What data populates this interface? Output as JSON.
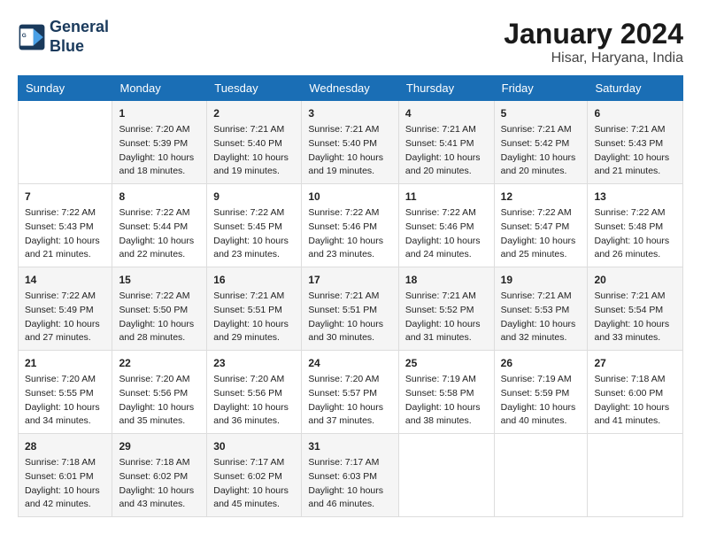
{
  "header": {
    "logo_line1": "General",
    "logo_line2": "Blue",
    "month_title": "January 2024",
    "location": "Hisar, Haryana, India"
  },
  "days_of_week": [
    "Sunday",
    "Monday",
    "Tuesday",
    "Wednesday",
    "Thursday",
    "Friday",
    "Saturday"
  ],
  "weeks": [
    [
      {
        "day": "",
        "sunrise": "",
        "sunset": "",
        "daylight": ""
      },
      {
        "day": "1",
        "sunrise": "Sunrise: 7:20 AM",
        "sunset": "Sunset: 5:39 PM",
        "daylight": "Daylight: 10 hours and 18 minutes."
      },
      {
        "day": "2",
        "sunrise": "Sunrise: 7:21 AM",
        "sunset": "Sunset: 5:40 PM",
        "daylight": "Daylight: 10 hours and 19 minutes."
      },
      {
        "day": "3",
        "sunrise": "Sunrise: 7:21 AM",
        "sunset": "Sunset: 5:40 PM",
        "daylight": "Daylight: 10 hours and 19 minutes."
      },
      {
        "day": "4",
        "sunrise": "Sunrise: 7:21 AM",
        "sunset": "Sunset: 5:41 PM",
        "daylight": "Daylight: 10 hours and 20 minutes."
      },
      {
        "day": "5",
        "sunrise": "Sunrise: 7:21 AM",
        "sunset": "Sunset: 5:42 PM",
        "daylight": "Daylight: 10 hours and 20 minutes."
      },
      {
        "day": "6",
        "sunrise": "Sunrise: 7:21 AM",
        "sunset": "Sunset: 5:43 PM",
        "daylight": "Daylight: 10 hours and 21 minutes."
      }
    ],
    [
      {
        "day": "7",
        "sunrise": "Sunrise: 7:22 AM",
        "sunset": "Sunset: 5:43 PM",
        "daylight": "Daylight: 10 hours and 21 minutes."
      },
      {
        "day": "8",
        "sunrise": "Sunrise: 7:22 AM",
        "sunset": "Sunset: 5:44 PM",
        "daylight": "Daylight: 10 hours and 22 minutes."
      },
      {
        "day": "9",
        "sunrise": "Sunrise: 7:22 AM",
        "sunset": "Sunset: 5:45 PM",
        "daylight": "Daylight: 10 hours and 23 minutes."
      },
      {
        "day": "10",
        "sunrise": "Sunrise: 7:22 AM",
        "sunset": "Sunset: 5:46 PM",
        "daylight": "Daylight: 10 hours and 23 minutes."
      },
      {
        "day": "11",
        "sunrise": "Sunrise: 7:22 AM",
        "sunset": "Sunset: 5:46 PM",
        "daylight": "Daylight: 10 hours and 24 minutes."
      },
      {
        "day": "12",
        "sunrise": "Sunrise: 7:22 AM",
        "sunset": "Sunset: 5:47 PM",
        "daylight": "Daylight: 10 hours and 25 minutes."
      },
      {
        "day": "13",
        "sunrise": "Sunrise: 7:22 AM",
        "sunset": "Sunset: 5:48 PM",
        "daylight": "Daylight: 10 hours and 26 minutes."
      }
    ],
    [
      {
        "day": "14",
        "sunrise": "Sunrise: 7:22 AM",
        "sunset": "Sunset: 5:49 PM",
        "daylight": "Daylight: 10 hours and 27 minutes."
      },
      {
        "day": "15",
        "sunrise": "Sunrise: 7:22 AM",
        "sunset": "Sunset: 5:50 PM",
        "daylight": "Daylight: 10 hours and 28 minutes."
      },
      {
        "day": "16",
        "sunrise": "Sunrise: 7:21 AM",
        "sunset": "Sunset: 5:51 PM",
        "daylight": "Daylight: 10 hours and 29 minutes."
      },
      {
        "day": "17",
        "sunrise": "Sunrise: 7:21 AM",
        "sunset": "Sunset: 5:51 PM",
        "daylight": "Daylight: 10 hours and 30 minutes."
      },
      {
        "day": "18",
        "sunrise": "Sunrise: 7:21 AM",
        "sunset": "Sunset: 5:52 PM",
        "daylight": "Daylight: 10 hours and 31 minutes."
      },
      {
        "day": "19",
        "sunrise": "Sunrise: 7:21 AM",
        "sunset": "Sunset: 5:53 PM",
        "daylight": "Daylight: 10 hours and 32 minutes."
      },
      {
        "day": "20",
        "sunrise": "Sunrise: 7:21 AM",
        "sunset": "Sunset: 5:54 PM",
        "daylight": "Daylight: 10 hours and 33 minutes."
      }
    ],
    [
      {
        "day": "21",
        "sunrise": "Sunrise: 7:20 AM",
        "sunset": "Sunset: 5:55 PM",
        "daylight": "Daylight: 10 hours and 34 minutes."
      },
      {
        "day": "22",
        "sunrise": "Sunrise: 7:20 AM",
        "sunset": "Sunset: 5:56 PM",
        "daylight": "Daylight: 10 hours and 35 minutes."
      },
      {
        "day": "23",
        "sunrise": "Sunrise: 7:20 AM",
        "sunset": "Sunset: 5:56 PM",
        "daylight": "Daylight: 10 hours and 36 minutes."
      },
      {
        "day": "24",
        "sunrise": "Sunrise: 7:20 AM",
        "sunset": "Sunset: 5:57 PM",
        "daylight": "Daylight: 10 hours and 37 minutes."
      },
      {
        "day": "25",
        "sunrise": "Sunrise: 7:19 AM",
        "sunset": "Sunset: 5:58 PM",
        "daylight": "Daylight: 10 hours and 38 minutes."
      },
      {
        "day": "26",
        "sunrise": "Sunrise: 7:19 AM",
        "sunset": "Sunset: 5:59 PM",
        "daylight": "Daylight: 10 hours and 40 minutes."
      },
      {
        "day": "27",
        "sunrise": "Sunrise: 7:18 AM",
        "sunset": "Sunset: 6:00 PM",
        "daylight": "Daylight: 10 hours and 41 minutes."
      }
    ],
    [
      {
        "day": "28",
        "sunrise": "Sunrise: 7:18 AM",
        "sunset": "Sunset: 6:01 PM",
        "daylight": "Daylight: 10 hours and 42 minutes."
      },
      {
        "day": "29",
        "sunrise": "Sunrise: 7:18 AM",
        "sunset": "Sunset: 6:02 PM",
        "daylight": "Daylight: 10 hours and 43 minutes."
      },
      {
        "day": "30",
        "sunrise": "Sunrise: 7:17 AM",
        "sunset": "Sunset: 6:02 PM",
        "daylight": "Daylight: 10 hours and 45 minutes."
      },
      {
        "day": "31",
        "sunrise": "Sunrise: 7:17 AM",
        "sunset": "Sunset: 6:03 PM",
        "daylight": "Daylight: 10 hours and 46 minutes."
      },
      {
        "day": "",
        "sunrise": "",
        "sunset": "",
        "daylight": ""
      },
      {
        "day": "",
        "sunrise": "",
        "sunset": "",
        "daylight": ""
      },
      {
        "day": "",
        "sunrise": "",
        "sunset": "",
        "daylight": ""
      }
    ]
  ]
}
